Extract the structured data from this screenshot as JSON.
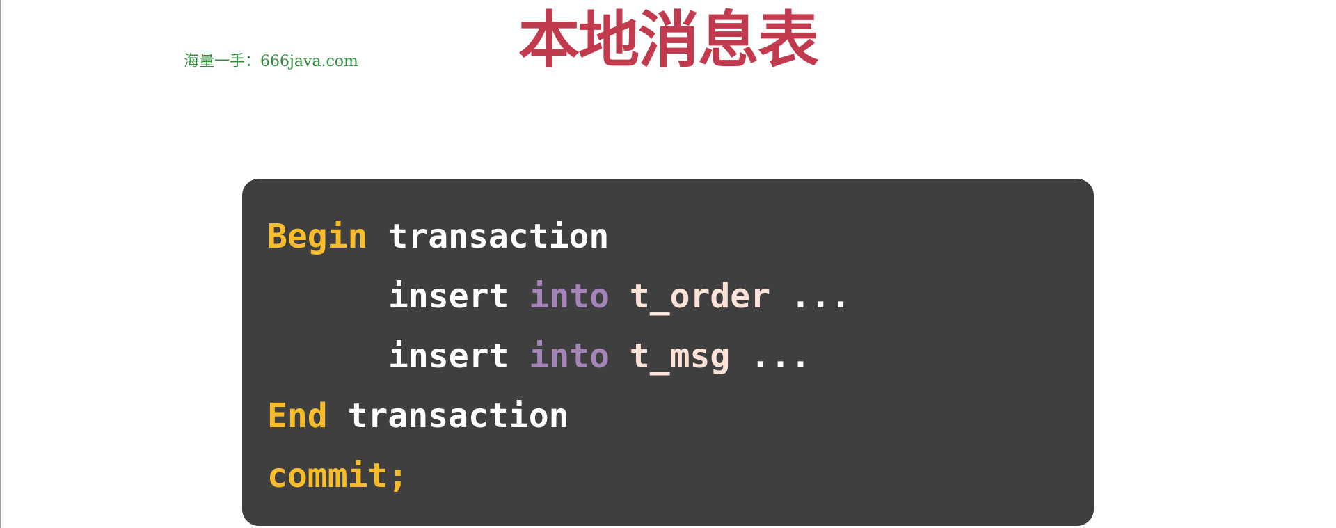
{
  "watermark": {
    "text": "海量一手：666java.com"
  },
  "title": "本地消息表",
  "colors": {
    "title": "#c23a4e",
    "watermark": "#2e8f3a",
    "panel_background": "#3f3f3f",
    "keyword_yellow": "#f6bc2b",
    "keyword_purple": "#a584ba",
    "identifier": "#fde2d8",
    "plain": "#ffffff"
  },
  "code": {
    "line1": {
      "kw": "Begin",
      "rest": "transaction"
    },
    "line2": {
      "cmd": "insert",
      "kw": "into",
      "table": "t_order",
      "tail": "..."
    },
    "line3": {
      "cmd": "insert",
      "kw": "into",
      "table": "t_msg",
      "tail": "..."
    },
    "line4": {
      "kw": "End",
      "rest": "transaction"
    },
    "line5": {
      "kw": "commit;"
    }
  }
}
